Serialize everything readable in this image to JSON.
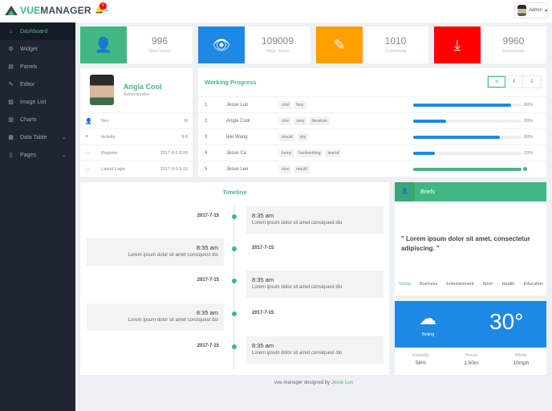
{
  "header": {
    "logo_prefix": "VUE",
    "logo_suffix": "MANAGER",
    "beta": "beta",
    "notifications": "5",
    "user": "Admin"
  },
  "sidebar": {
    "items": [
      {
        "label": "Dashboard",
        "icon": "home-icon"
      },
      {
        "label": "Widget",
        "icon": "cogs-icon"
      },
      {
        "label": "Panels",
        "icon": "panel-icon"
      },
      {
        "label": "Editor",
        "icon": "pencil-icon"
      },
      {
        "label": "Image List",
        "icon": "image-icon"
      },
      {
        "label": "Charts",
        "icon": "chart-icon"
      },
      {
        "label": "Data Table",
        "icon": "table-icon"
      },
      {
        "label": "Pages",
        "icon": "file-icon"
      }
    ]
  },
  "stats": [
    {
      "value": "996",
      "label": "New Users",
      "color": "#41b883"
    },
    {
      "value": "109009",
      "label": "Page Views",
      "color": "#1e88e5"
    },
    {
      "value": "1010",
      "label": "Comments",
      "color": "#ff9f00"
    },
    {
      "value": "9960",
      "label": "Downloads",
      "color": "#f00"
    }
  ],
  "profile": {
    "name": "Angla Cool",
    "role": "Administrator",
    "rows": [
      {
        "label": "Sex",
        "value": "M"
      },
      {
        "label": "Activity",
        "value": "9.8"
      },
      {
        "label": "Register",
        "value": "2017-8-9 8:00"
      },
      {
        "label": "Latest Login",
        "value": "2017-9-9 9:10"
      }
    ]
  },
  "progress": {
    "title": "Working Progress",
    "rows": [
      {
        "n": "1",
        "name": "Jesse Luo",
        "tags": [
          "cool",
          "funy"
        ],
        "pct": 90,
        "pct_label": "90%",
        "color": "#1e88e5"
      },
      {
        "n": "2",
        "name": "Angla Cool",
        "tags": [
          "nice",
          "sexy",
          "literature"
        ],
        "pct": 30,
        "pct_label": "30%",
        "color": "#1e88e5"
      },
      {
        "n": "3",
        "name": "lele Wang",
        "tags": [
          "mould",
          "shy"
        ],
        "pct": 80,
        "pct_label": "80%",
        "color": "#1e88e5"
      },
      {
        "n": "4",
        "name": "Jesse Ca",
        "tags": [
          "funny",
          "hardworking",
          "learnd"
        ],
        "pct": 20,
        "pct_label": "20%",
        "color": "#1e88e5"
      },
      {
        "n": "5",
        "name": "Jesse Lee",
        "tags": [
          "nice",
          "mould"
        ],
        "pct": 100,
        "pct_label": "",
        "color": "#41b883"
      }
    ]
  },
  "timeline": {
    "title": "Timeline",
    "items": [
      {
        "date": "2017-7-15",
        "time": "8:35 am",
        "desc": "Lorem ipsum dolor sit amet consiquest dio"
      },
      {
        "date": "2017-7-15",
        "time": "8:35 am",
        "desc": "Lorem ipsum dolor sit amet consiquest dio"
      },
      {
        "date": "2017-7-15",
        "time": "8:35 am",
        "desc": "Lorem ipsum dolor sit amet consiquest dio"
      },
      {
        "date": "2017-7-15",
        "time": "8:35 am",
        "desc": "Lorem ipsum dolor sit amet consiquest dio"
      },
      {
        "date": "2017-7-15",
        "time": "8:35 am",
        "desc": "Lorem ipsum dolor sit amet consiquest dio"
      }
    ]
  },
  "briefs": {
    "title": "Briefs",
    "quote": "\" Lorem ipsum dolor sit amet, consectetur adipiscing. \"",
    "tabs": [
      "Social",
      "Business",
      "Entertainment",
      "Sport",
      "Health",
      "Education"
    ]
  },
  "weather": {
    "city": "Beijng",
    "temp": "30°",
    "stats": [
      {
        "label": "Humidity",
        "value": "56%"
      },
      {
        "label": "Precip",
        "value": "1.50in"
      },
      {
        "label": "Winds",
        "value": "10mph"
      }
    ]
  },
  "footer": {
    "text": "vue-manager designed by ",
    "author": "Jesse Luo"
  }
}
